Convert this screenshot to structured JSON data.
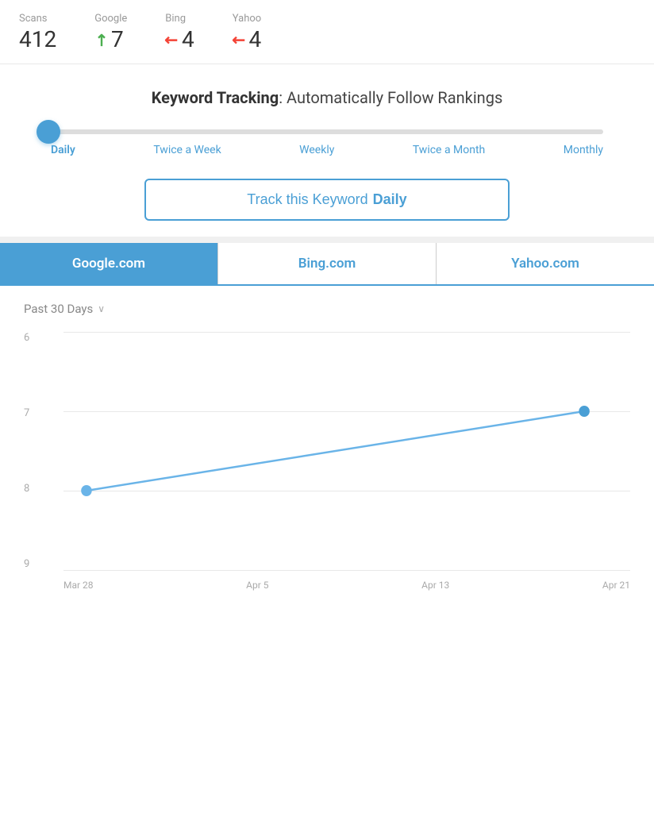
{
  "stats": {
    "scans": {
      "label": "Scans",
      "value": "412",
      "arrow": null
    },
    "google": {
      "label": "Google",
      "value": "7",
      "arrow": "up"
    },
    "bing": {
      "label": "Bing",
      "value": "4",
      "arrow": "down"
    },
    "yahoo": {
      "label": "Yahoo",
      "value": "4",
      "arrow": "down"
    }
  },
  "keyword_tracking": {
    "title_bold": "Keyword Tracking",
    "title_normal": ": Automatically Follow Rankings",
    "slider_labels": [
      "Daily",
      "Twice a Week",
      "Weekly",
      "Twice a Month",
      "Monthly"
    ],
    "active_label": "Daily",
    "track_button_prefix": "Track this Keyword ",
    "track_button_suffix": "Daily"
  },
  "tabs": [
    {
      "label": "Google.com",
      "active": true
    },
    {
      "label": "Bing.com",
      "active": false
    },
    {
      "label": "Yahoo.com",
      "active": false
    }
  ],
  "chart": {
    "period_label": "Past 30 Days",
    "y_labels": [
      "6",
      "7",
      "8",
      "9"
    ],
    "x_labels": [
      "Mar 28",
      "Apr 5",
      "Apr 13",
      "Apr 21"
    ],
    "data_points": [
      {
        "x": 0,
        "y": 8,
        "label": "Mar 28"
      },
      {
        "x": 1,
        "y": 7,
        "label": "Apr 21"
      }
    ]
  }
}
